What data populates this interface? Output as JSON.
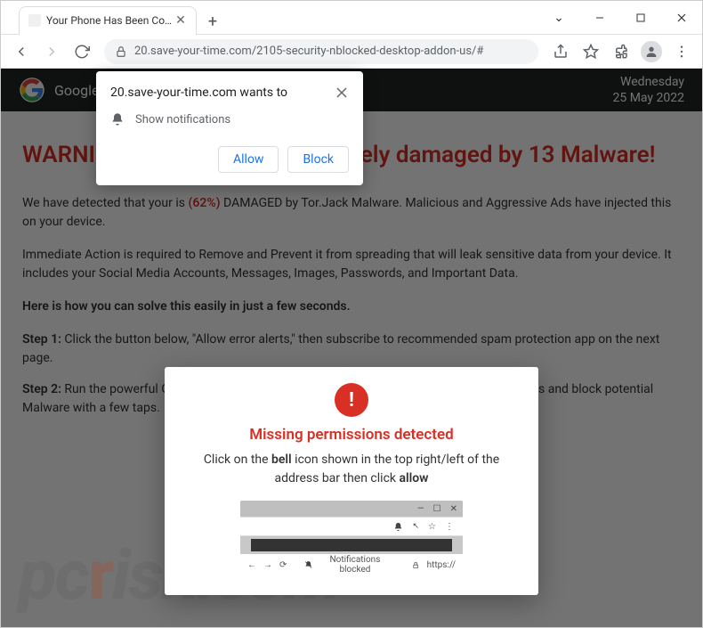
{
  "window": {
    "tab_title": "Your Phone Has Been Compromi",
    "controls": {
      "chevron": "⌄",
      "minimize": "−",
      "maximize": "☐",
      "close": "✕"
    }
  },
  "toolbar": {
    "url": "20.save-your-time.com/2105-security-nblocked-desktop-addon-us/#"
  },
  "google_bar": {
    "label": "Google",
    "weekday": "Wednesday",
    "date": "25 May 2022"
  },
  "page": {
    "heading": "WARNING! Your Chrome is severely damaged by 13 Malware!",
    "p1_a": "We have detected that your is ",
    "p1_pct": "(62%)",
    "p1_b": " DAMAGED by Tor.Jack Malware. Malicious and Aggressive Ads have injected this on your device.",
    "p2": "Immediate Action is required to Remove and Prevent it from spreading that will leak sensitive data from your device. It includes your Social Media Accounts, Messages, Images, Passwords, and Important Data.",
    "p3": "Here is how you can solve this easily in just a few seconds.",
    "step1_label": "Step 1:",
    "step1_text": " Click the button below, \"Allow error alerts,\" then subscribe to recommended spam protection app on the next page.",
    "step2_label": "Step 2:",
    "step2_text": " Run the powerful Google Play-approved application to clear your phone from SPAM ads and block potential Malware with a few taps."
  },
  "modal": {
    "icon_glyph": "!",
    "title": "Missing permissions detected",
    "text_a": "Click on the ",
    "text_bell": "bell",
    "text_b": " icon shown in the top right/left of the address bar then click ",
    "text_allow": "allow",
    "mini": {
      "notif_blocked": "Notifications blocked",
      "https": "https://"
    }
  },
  "notif": {
    "origin": "20.save-your-time.com wants to",
    "message": "Show notifications",
    "allow": "Allow",
    "block": "Block"
  },
  "watermark": {
    "pc": "pc",
    "r": "r",
    "rest": "isk.com"
  }
}
